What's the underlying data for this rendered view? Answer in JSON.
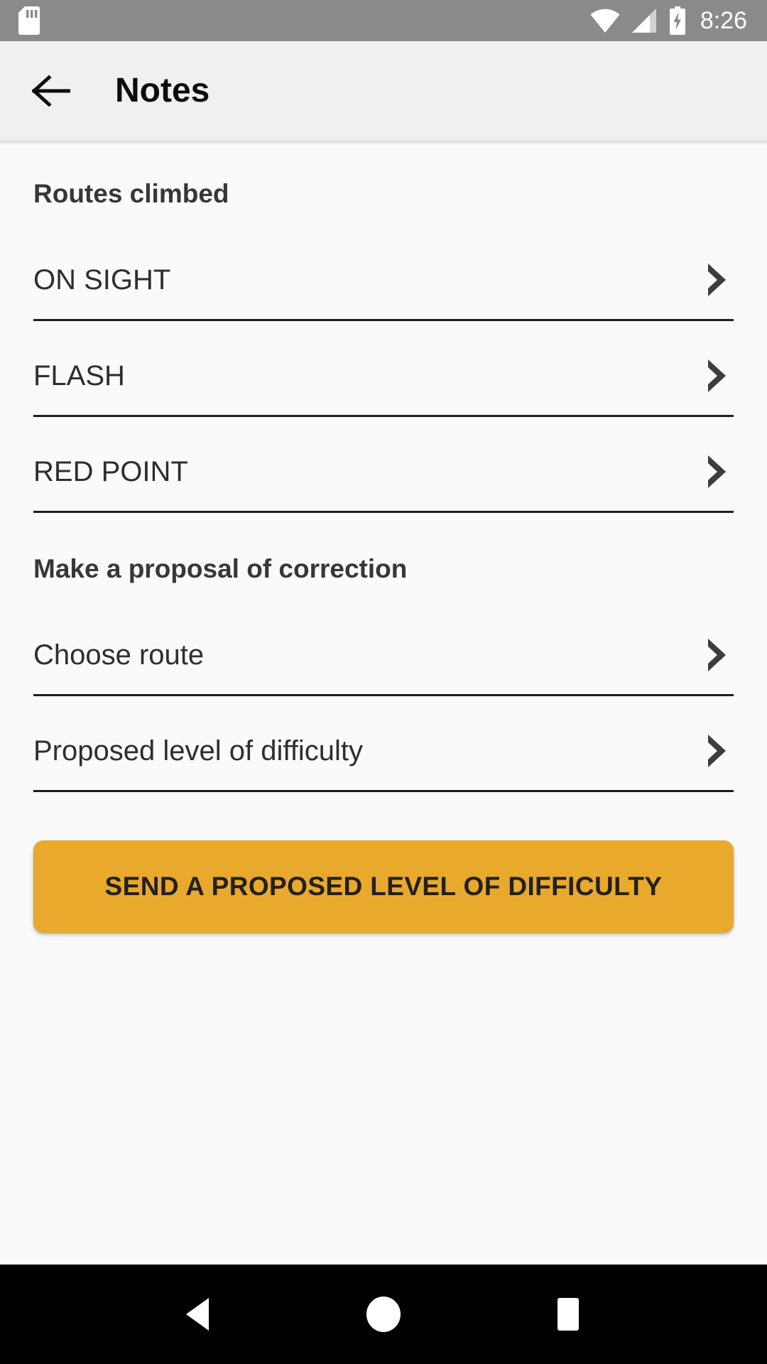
{
  "status_bar": {
    "background": "#8a8a8a",
    "time": "8:26",
    "icons": [
      "sd-card-icon",
      "wifi-icon",
      "cellular-signal-icon",
      "battery-charging-icon"
    ]
  },
  "app_bar": {
    "background": "#f0f0f0",
    "back_icon": "back-arrow-icon",
    "title": "Notes"
  },
  "content": {
    "sections": [
      {
        "title": "Routes climbed",
        "rows": [
          {
            "label": "ON SIGHT",
            "chevron": "chevron-right-icon"
          },
          {
            "label": "FLASH",
            "chevron": "chevron-right-icon"
          },
          {
            "label": "RED POINT",
            "chevron": "chevron-right-icon"
          }
        ]
      },
      {
        "title": "Make a proposal of correction",
        "rows": [
          {
            "label": "Choose route",
            "chevron": "chevron-right-icon"
          },
          {
            "label": "Proposed level of difficulty",
            "chevron": "chevron-right-icon"
          }
        ]
      }
    ],
    "primary_button": {
      "label": "SEND A PROPOSED LEVEL OF DIFFICULTY",
      "background": "#e9a92c",
      "text_color": "#212121"
    }
  },
  "nav_bar": {
    "background": "#000000",
    "buttons": [
      {
        "name": "back",
        "icon": "nav-back-triangle-icon"
      },
      {
        "name": "home",
        "icon": "nav-home-circle-icon"
      },
      {
        "name": "recents",
        "icon": "nav-recents-square-icon"
      }
    ]
  }
}
